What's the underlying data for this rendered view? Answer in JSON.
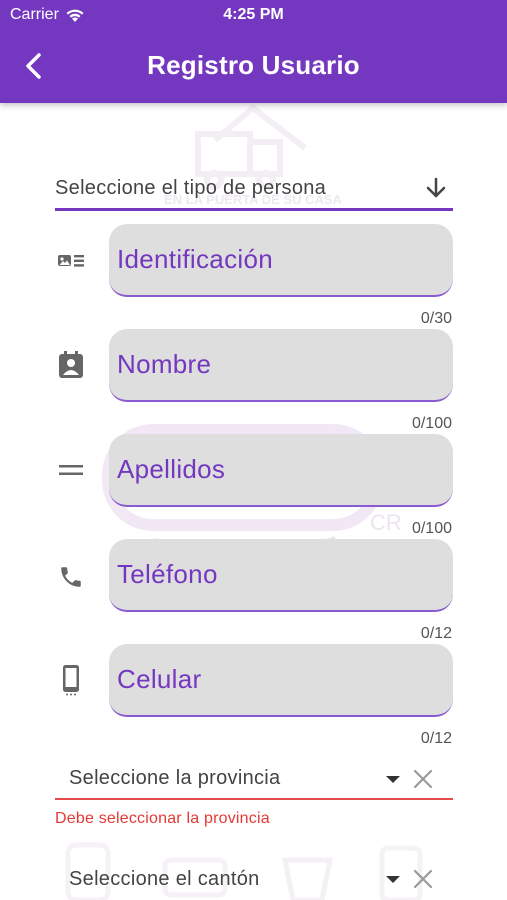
{
  "status_bar": {
    "carrier": "Carrier",
    "time": "4:25 PM"
  },
  "header": {
    "title": "Registro Usuario",
    "back_icon": "chevron-left-icon"
  },
  "watermark": {
    "tagline": "EN LA PUERTA DE SU CASA",
    "logo_text": "OXO",
    "logo_suffix": "CR",
    "slogan": "Productos Básicos Seleccionados"
  },
  "person_type_select": {
    "label": "Seleccione el tipo de persona",
    "icon": "arrow-down-icon"
  },
  "fields": [
    {
      "label": "Identificación",
      "counter": "0/30",
      "icon": "id-card-icon"
    },
    {
      "label": "Nombre",
      "counter": "0/100",
      "icon": "contact-badge-icon"
    },
    {
      "label": "Apellidos",
      "counter": "0/100",
      "icon": "equals-icon"
    },
    {
      "label": "Teléfono",
      "counter": "0/12",
      "icon": "phone-icon"
    },
    {
      "label": "Celular",
      "counter": "0/12",
      "icon": "mobile-phone-icon"
    }
  ],
  "province_select": {
    "label": "Seleccione la provincia",
    "error": "Debe seleccionar la provincia"
  },
  "canton_select": {
    "label": "Seleccione el cantón"
  },
  "colors": {
    "primary": "#7437bf",
    "error": "#e53935",
    "field_bg": "#dedede"
  }
}
